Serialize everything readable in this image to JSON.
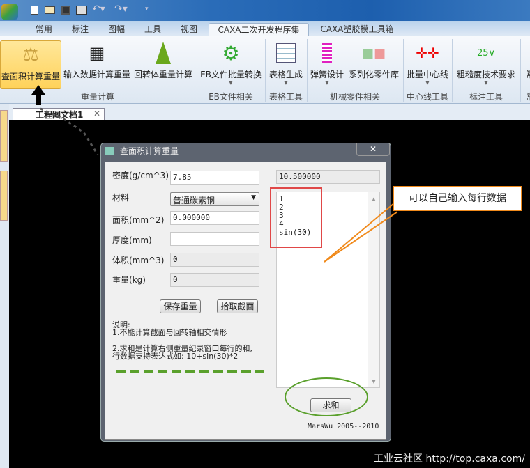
{
  "quick_access": {
    "icons": [
      "app-logo-icon",
      "new-file-icon",
      "open-icon",
      "save-icon",
      "print-icon",
      "undo-icon",
      "redo-icon",
      "customize-icon"
    ]
  },
  "tabs": [
    "常用",
    "标注",
    "图幅",
    "工具",
    "视图",
    "CAXA二次开发程序集",
    "CAXA塑胶模工具箱"
  ],
  "active_tab": "CAXA二次开发程序集",
  "ribbon": {
    "buttons": [
      "查面积计算重量",
      "输入数据计算重量",
      "回转体重量计算",
      "EB文件批量转换",
      "表格生成",
      "弹簧设计",
      "系列化零件库",
      "批量中心线",
      "粗糙度技术要求",
      "常"
    ],
    "groups": [
      "重量计算",
      "EB文件相关",
      "表格工具",
      "机械零件相关",
      "中心线工具",
      "标注工具",
      "常"
    ],
    "roughness_value": "25"
  },
  "document_tab": "工程图文档1",
  "dialog": {
    "title": "查面积计算重量",
    "close": "✕",
    "fields": [
      {
        "label": "密度(g/cm^3)",
        "value": "7.85"
      },
      {
        "label": "材料",
        "value": "普通碳素钢"
      },
      {
        "label": "面积(mm^2)",
        "value": "0.000000"
      },
      {
        "label": "厚度(mm)",
        "value": ""
      },
      {
        "label": "体积(mm^3)",
        "value": "0"
      },
      {
        "label": "重量(kg)",
        "value": "0"
      }
    ],
    "save_button": "保存重量",
    "pick_button": "拾取截面",
    "notes": [
      "说明:",
      "1.不能计算截面与回转轴相交情形",
      "2.求和是计算右侧重量纪录窗口每行的和,",
      "行数据支持表达式如: 10+sin(30)*2"
    ],
    "sum_result": "10.500000",
    "records": [
      "1",
      "2",
      "3",
      "4",
      "sin(30)"
    ],
    "sum_button": "求和",
    "credit": "MarsWu 2005--2010"
  },
  "annotation": {
    "callout": "可以自己输入每行数据",
    "colors": {
      "red_box": "#e04848",
      "callout_border": "#f08a1c",
      "ellipse": "#5aa02c",
      "dashes": "#5aa02c"
    }
  },
  "watermark": "工业云社区 http://top.caxa.com/"
}
